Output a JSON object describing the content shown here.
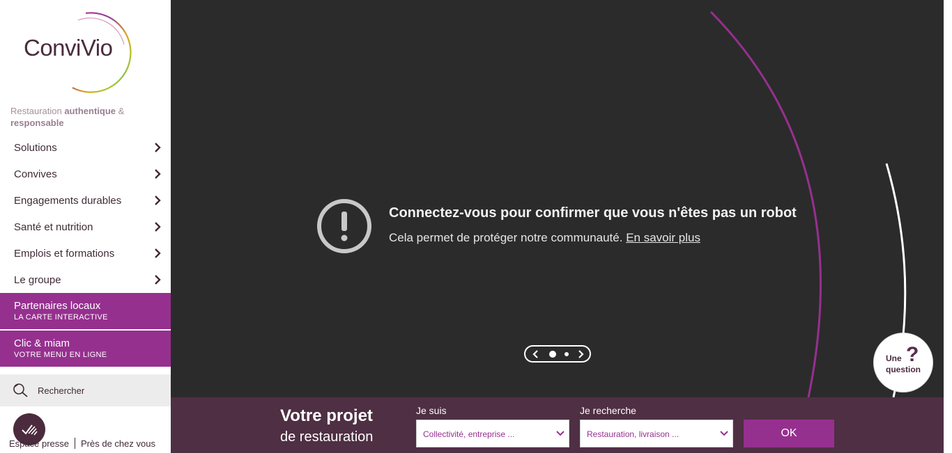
{
  "brand": {
    "logo_text": "ConviVio",
    "tagline_part1": "Restauration ",
    "tagline_bold1": "authentique",
    "tagline_part2": " & ",
    "tagline_bold2": "responsable"
  },
  "nav": {
    "items": [
      {
        "label": "Solutions"
      },
      {
        "label": "Convives"
      },
      {
        "label": "Engagements durables"
      },
      {
        "label": "Santé et nutrition"
      },
      {
        "label": "Emplois et formations"
      },
      {
        "label": "Le groupe"
      }
    ],
    "promo1": {
      "title": "Partenaires locaux",
      "subtitle": "LA CARTE INTERACTIVE"
    },
    "promo2": {
      "title": "Clic & miam",
      "subtitle": "VOTRE MENU EN LIGNE"
    }
  },
  "search": {
    "placeholder": "Rechercher"
  },
  "footer": {
    "link1": "Espace presse",
    "link2": "Près de chez vous"
  },
  "hero": {
    "alert_title": "Connectez-vous pour confirmer que vous n'êtes pas un robot",
    "alert_text": "Cela permet de protéger notre communauté. ",
    "alert_link": "En savoir plus",
    "slides_total": 2,
    "active_slide": 1
  },
  "help": {
    "line1": "Une",
    "line2": "question",
    "mark": "?"
  },
  "project": {
    "title1": "Votre projet",
    "title2": "de restauration",
    "label1": "Je suis",
    "select1": "Collectivité, entreprise ...",
    "label2": "Je recherche",
    "select2": "Restauration, livraison ...",
    "ok": "OK"
  },
  "colors": {
    "accent": "#96308f",
    "dark_plum": "#4f2f43",
    "hero_bg": "#2b2b2b"
  }
}
